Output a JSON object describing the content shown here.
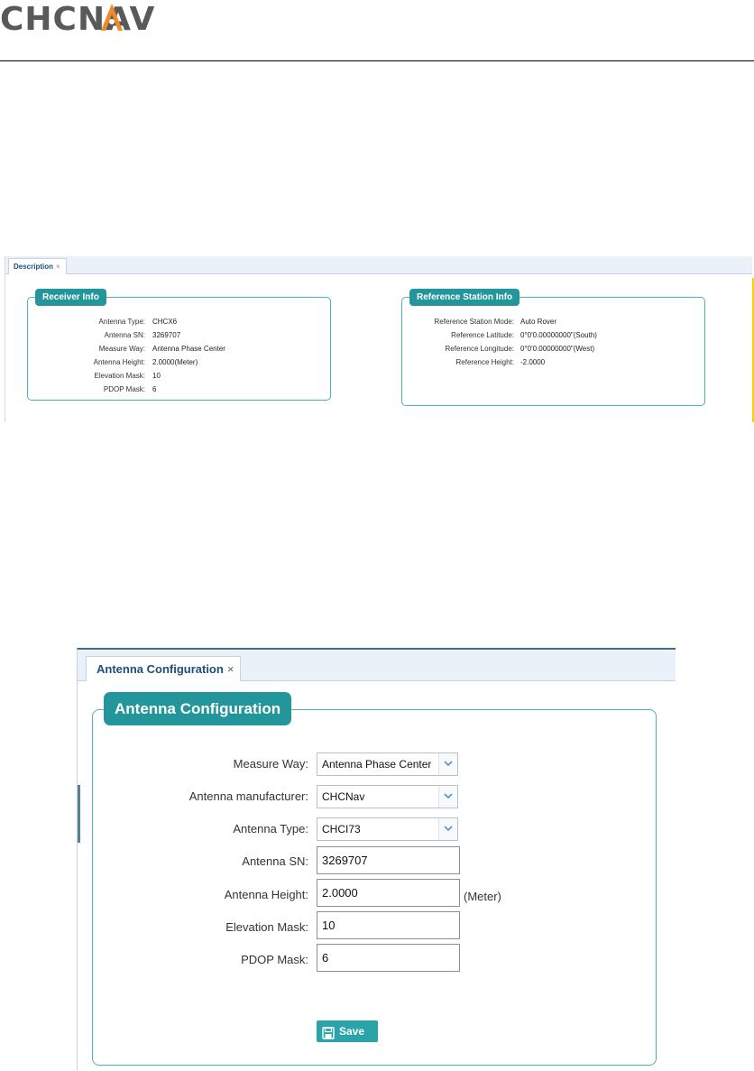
{
  "brand": {
    "logo_text": "CHCNAV",
    "accent": "#f08a24",
    "text_color": "#58595b"
  },
  "description_view": {
    "tab": {
      "label": "Description",
      "close": "×"
    },
    "receiver_info": {
      "title": "Receiver Info",
      "rows": [
        {
          "label": "Antenna Type:",
          "value": "CHCX6"
        },
        {
          "label": "Antenna SN:",
          "value": "3269707"
        },
        {
          "label": "Measure Way:",
          "value": "Antenna Phase Center"
        },
        {
          "label": "Antenna Height:",
          "value": "2.0000(Meter)"
        },
        {
          "label": "Elevation Mask:",
          "value": "10"
        },
        {
          "label": "PDOP Mask:",
          "value": "6"
        }
      ]
    },
    "reference_station_info": {
      "title": "Reference Station Info",
      "rows": [
        {
          "label": "Reference Station Mode:",
          "value": "Auto Rover"
        },
        {
          "label": "Reference Latitude:",
          "value": "0°0'0.00000000\"(South)"
        },
        {
          "label": "Reference Longitude:",
          "value": "0°0'0.00000000\"(West)"
        },
        {
          "label": "Reference Height:",
          "value": "-2.0000"
        }
      ]
    }
  },
  "antenna_config_view": {
    "tab": {
      "label": "Antenna Configuration",
      "close": "×"
    },
    "title": "Antenna Configuration",
    "fields": {
      "measure_way": {
        "label": "Measure Way:",
        "value": "Antenna Phase Center"
      },
      "manufacturer": {
        "label": "Antenna manufacturer:",
        "value": "CHCNav"
      },
      "antenna_type": {
        "label": "Antenna Type:",
        "value": "CHCI73"
      },
      "antenna_sn": {
        "label": "Antenna SN:",
        "value": "3269707"
      },
      "antenna_height": {
        "label": "Antenna Height:",
        "value": "2.0000",
        "unit": "(Meter)"
      },
      "elevation_mask": {
        "label": "Elevation Mask:",
        "value": "10"
      },
      "pdop_mask": {
        "label": "PDOP Mask:",
        "value": "6"
      }
    },
    "save_button": {
      "label": "Save",
      "icon": "floppy-disk-icon"
    },
    "colors": {
      "teal": "#22969a",
      "border": "#4eb1b4"
    }
  }
}
